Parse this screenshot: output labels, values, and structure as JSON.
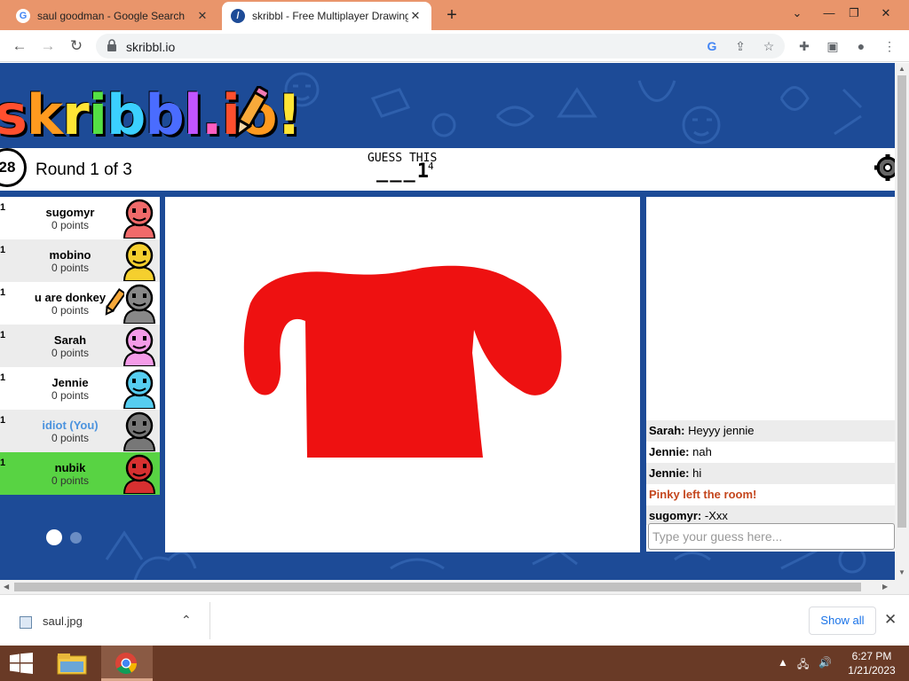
{
  "browser": {
    "tabs": [
      {
        "title": "saul goodman - Google Search",
        "active": false
      },
      {
        "title": "skribbl - Free Multiplayer Drawing",
        "active": true
      }
    ],
    "url": "skribbl.io",
    "window_buttons": {
      "minimize": "—",
      "restore": "❐",
      "close": "✕",
      "tabsearch": "⌄"
    }
  },
  "game": {
    "logo_letters": [
      "s",
      "k",
      "r",
      "i",
      "b",
      "b",
      "l",
      ".",
      "i",
      "o",
      "!"
    ],
    "logo_colors": [
      "#ff4f2e",
      "#ff9a1f",
      "#ffe535",
      "#55e044",
      "#3bd0ff",
      "#4a6cff",
      "#c155ff",
      "#ff5ec1",
      "#ff4f2e",
      "#ff9a1f",
      "#ffe535"
    ],
    "timer": "28",
    "round": "Round 1 of 3",
    "guess_label": "GUESS THIS",
    "word_hint": "___1",
    "word_length": "4",
    "players": [
      {
        "rank": "1",
        "name": "sugomyr",
        "points": "0 points",
        "row": "light",
        "avatar_color": "#f06a6a",
        "you": false,
        "drawing": false
      },
      {
        "rank": "1",
        "name": "mobino",
        "points": "0 points",
        "row": "grey",
        "avatar_color": "#f5cf2e",
        "you": false,
        "drawing": false
      },
      {
        "rank": "1",
        "name": "u are donkey",
        "points": "0 points",
        "row": "light",
        "avatar_color": "#888888",
        "you": false,
        "drawing": true
      },
      {
        "rank": "1",
        "name": "Sarah",
        "points": "0 points",
        "row": "grey",
        "avatar_color": "#f49be8",
        "you": false,
        "drawing": false
      },
      {
        "rank": "1",
        "name": "Jennie",
        "points": "0 points",
        "row": "light",
        "avatar_color": "#56cdf0",
        "you": false,
        "drawing": false
      },
      {
        "rank": "1",
        "name": "idiot (You)",
        "points": "0 points",
        "row": "grey",
        "avatar_color": "#777777",
        "you": true,
        "drawing": false
      },
      {
        "rank": "1",
        "name": "nubik",
        "points": "0 points",
        "row": "green",
        "avatar_color": "#d73030",
        "you": false,
        "drawing": false
      }
    ],
    "drawing_color": "#ee1111",
    "chat": [
      {
        "author": "Sarah:",
        "text": "Heyyy jennie",
        "type": "user"
      },
      {
        "author": "Jennie:",
        "text": "nah",
        "type": "user"
      },
      {
        "author": "Jennie:",
        "text": "hi",
        "type": "user"
      },
      {
        "author": "",
        "text": "Pinky left the room!",
        "type": "system"
      },
      {
        "author": "sugomyr:",
        "text": "-Xxx",
        "type": "user"
      }
    ],
    "chat_placeholder": "Type your guess here..."
  },
  "downloads": {
    "file": "saul.jpg",
    "show_all": "Show all"
  },
  "taskbar": {
    "time": "6:27 PM",
    "date": "1/21/2023"
  }
}
